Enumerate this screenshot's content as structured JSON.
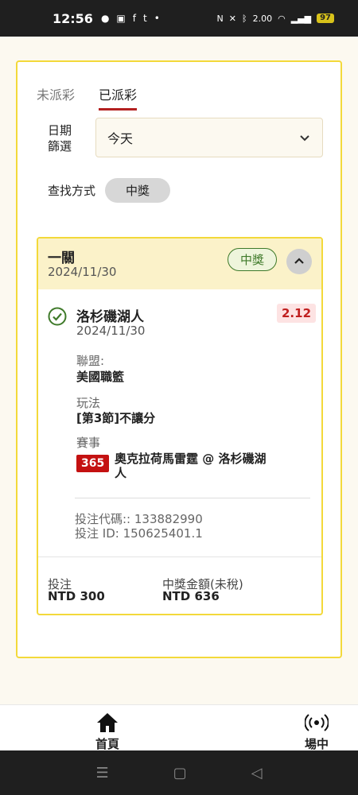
{
  "status_bar": {
    "time": "12:56",
    "speed": "2.00",
    "speed_unit": "KB/S",
    "battery": "97"
  },
  "tabs": [
    {
      "label": "未派彩",
      "active": false
    },
    {
      "label": "已派彩",
      "active": true
    }
  ],
  "filter": {
    "date_label": "日期\n篩選",
    "date_value": "今天",
    "search_label": "查找方式",
    "search_chip": "中獎"
  },
  "bet": {
    "title": "一關",
    "date": "2024/11/30",
    "status": "中獎",
    "team": "洛杉磯湖人",
    "team_date": "2024/11/30",
    "odds": "2.12",
    "league_label": "聯盟:",
    "league_value": "美國職籃",
    "play_label": "玩法",
    "play_value": "[第3節]不讓分",
    "event_label": "賽事",
    "event_badge": "365",
    "event_value": "奧克拉荷馬雷霆 @ 洛杉磯湖人",
    "bet_code": "投注代碼:: 133882990",
    "bet_id": "投注 ID: 150625401.1",
    "stake_label": "投注",
    "stake_value": "NTD 300",
    "payout_label": "中獎金額(未稅)",
    "payout_value": "NTD 636"
  },
  "bottom_nav": [
    {
      "label": "首頁",
      "icon": "home-icon"
    },
    {
      "label": "場中",
      "icon": "live-icon"
    }
  ],
  "colors": {
    "accent": "#b32020",
    "border": "#f3d93a",
    "win": "#3f7a2a",
    "odds": "#c01f1f"
  }
}
